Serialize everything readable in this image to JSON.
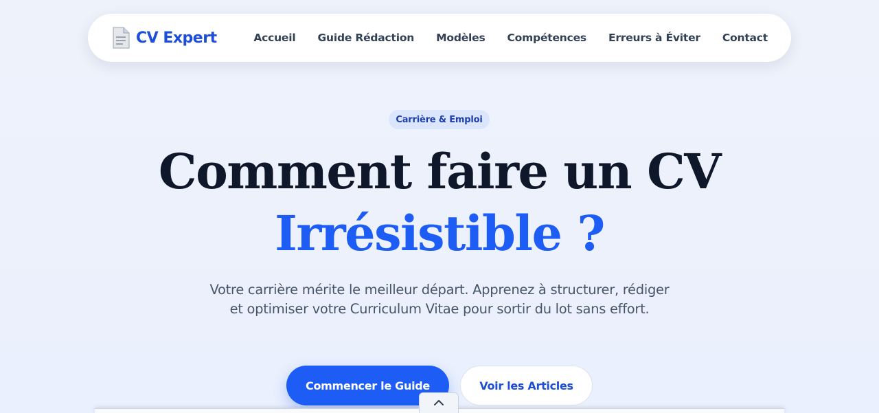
{
  "nav": {
    "logo_text": "CV Expert",
    "logo_icon": "document-icon",
    "links": [
      {
        "label": "Accueil"
      },
      {
        "label": "Guide Rédaction"
      },
      {
        "label": "Modèles"
      },
      {
        "label": "Compétences"
      },
      {
        "label": "Erreurs à Éviter"
      },
      {
        "label": "Contact"
      }
    ]
  },
  "hero": {
    "badge": "Carrière & Emploi",
    "title_line1": "Comment faire un CV",
    "title_line2": "Irrésistible ?",
    "subtitle": "Votre carrière mérite le meilleur départ. Apprenez à structurer, rédiger et optimiser votre Curriculum Vitae pour sortir du lot sans effort.",
    "cta_primary": "Commencer le Guide",
    "cta_secondary": "Voir les Articles"
  },
  "colors": {
    "accent": "#1d5cf5",
    "logo": "#1d4ed8",
    "heading": "#0f172a",
    "badge_bg": "#dbe6fd"
  },
  "icons": {
    "scroll_toggle": "chevron-up-icon"
  }
}
